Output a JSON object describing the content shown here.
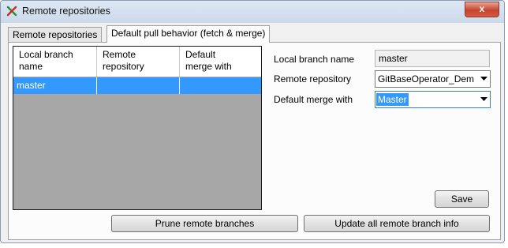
{
  "window": {
    "title": "Remote repositories",
    "close_label": "x"
  },
  "tabs": [
    {
      "label": "Remote repositories"
    },
    {
      "label": "Default pull behavior (fetch & merge)"
    }
  ],
  "grid": {
    "columns": [
      "Local branch\nname",
      "Remote\nrepository",
      "Default\nmerge with"
    ],
    "rows": [
      {
        "local_branch": "master",
        "remote_repository": "",
        "merge_with": ""
      }
    ]
  },
  "form": {
    "local_branch_label": "Local branch name",
    "local_branch_value": "master",
    "remote_repository_label": "Remote repository",
    "remote_repository_value": "GitBaseOperator_Dem",
    "merge_with_label": "Default merge with",
    "merge_with_value": "Master"
  },
  "buttons": {
    "save": "Save",
    "prune": "Prune remote branches",
    "update": "Update all remote branch info"
  },
  "icons": {
    "app": "git-extensions-icon",
    "close": "close-icon",
    "dropdown": "chevron-down-icon"
  }
}
